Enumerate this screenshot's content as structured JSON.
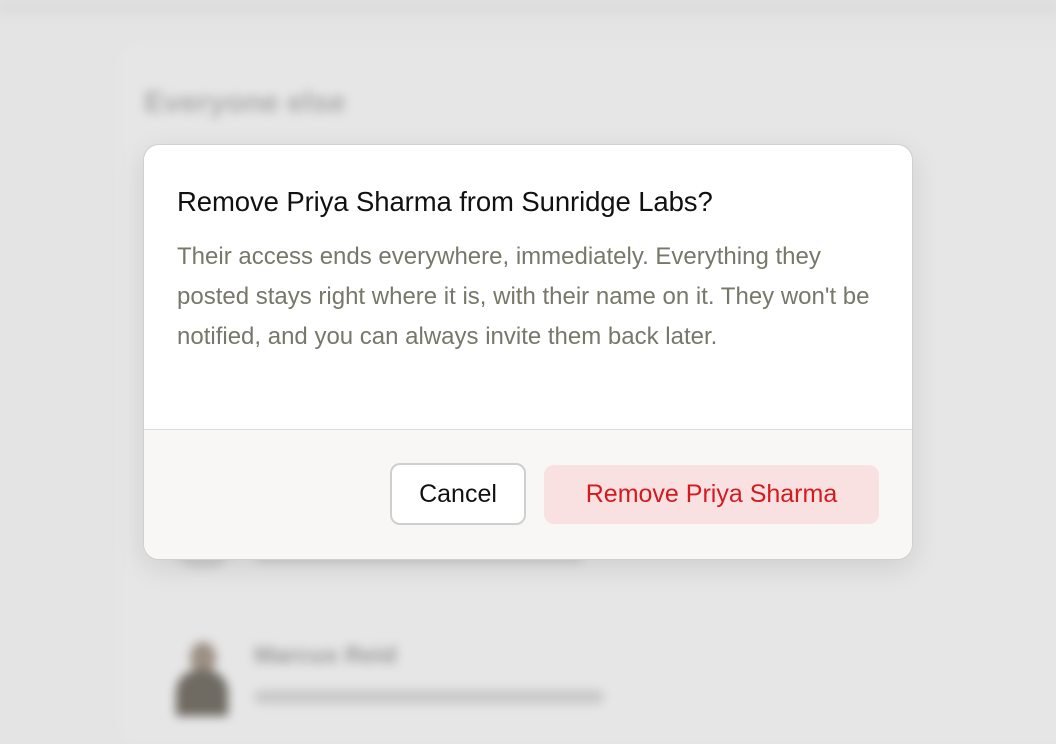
{
  "background": {
    "section_heading": "Everyone else",
    "members": [
      {
        "name": "Marcus Reid"
      }
    ]
  },
  "dialog": {
    "title": "Remove Priya Sharma from Sunridge Labs?",
    "message": "Their access ends everywhere, immediately. Everything they posted stays right where it is, with their name on it. They won't be notified, and you can always invite them back later.",
    "cancel_label": "Cancel",
    "confirm_label": "Remove Priya Sharma"
  },
  "colors": {
    "destructive_text": "#d41a1f",
    "destructive_bg": "#f9e1e2",
    "overlay_bg": "#e4e4e4"
  }
}
